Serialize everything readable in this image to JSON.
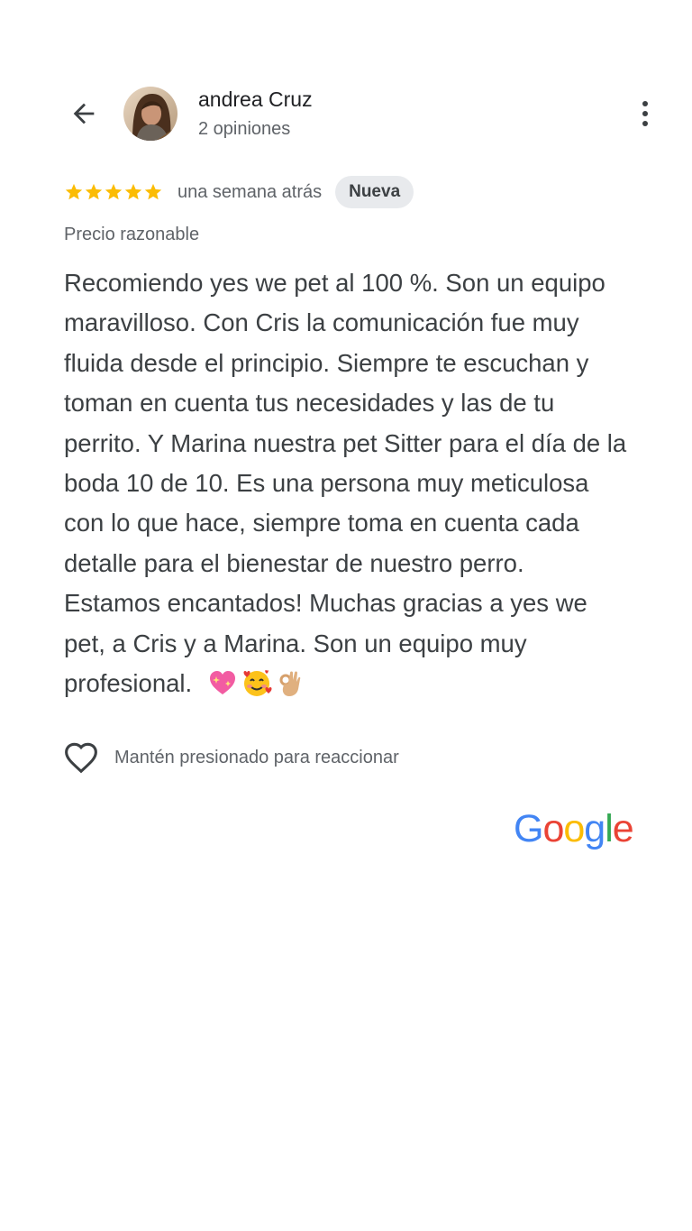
{
  "header": {
    "user_name": "andrea Cruz",
    "review_count": "2 opiniones"
  },
  "review": {
    "rating": 5,
    "max_rating": 5,
    "time_ago": "una semana atrás",
    "badge": "Nueva",
    "price_label": "Precio razonable",
    "text_lines": [
      "Recomiendo yes we pet al 100 %. Son un equipo",
      "maravilloso. Con Cris la comunicación fue muy",
      "fluida desde el principio. Siempre te escuchan y",
      "toman en cuenta tus necesidades y las de tu",
      "perrito. Y Marina nuestra pet Sitter para el día de la",
      "boda 10 de 10. Es una persona muy meticulosa",
      "con lo que hace, siempre toma en cuenta cada",
      "detalle para el bienestar de nuestro perro.",
      "Estamos encantados! Muchas gracias a yes we",
      "pet, a Cris y a Marina. Son un equipo muy",
      "profesional."
    ],
    "emojis": [
      "sparkling-heart",
      "smiling-face-with-hearts",
      "ok-hand"
    ]
  },
  "reaction": {
    "label": "Mantén presionado para reaccionar"
  },
  "brand": {
    "logo_text": "Google",
    "colors": {
      "blue": "#4285F4",
      "red": "#EA4335",
      "yellow": "#FBBC05",
      "green": "#34A853"
    }
  },
  "icons": {
    "back": "arrow-back-icon",
    "more": "more-vert-icon",
    "star": "star-icon",
    "heart": "heart-outline-icon"
  },
  "colors": {
    "star": "#FBBC04",
    "badge_bg": "#e8eaed",
    "secondary_text": "#5f6368",
    "body_text": "#3c4043"
  }
}
